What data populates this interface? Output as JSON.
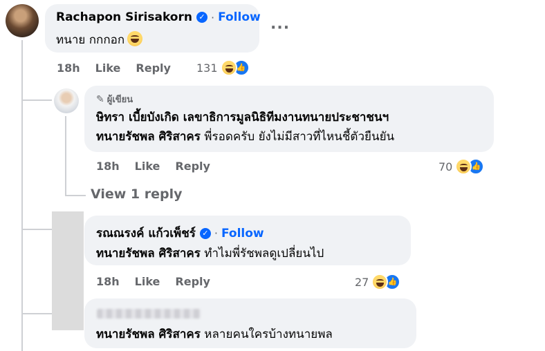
{
  "comments": [
    {
      "author": "Rachapon Sirisakorn",
      "follow": "Follow",
      "text": "ทนาย กกกอก",
      "time": "18h",
      "like": "Like",
      "reply": "Reply",
      "reactions": "131"
    },
    {
      "badge": "ผู้เขียน",
      "author": "ษิทรา เบี้ยบังเกิด เลขาธิการมูลนิธิทีมงานทนายประชาชนฯ",
      "mention": "ทนายรัชพล ศิริสาคร",
      "text": " พี่รอดครับ ยังไม่มีสาวที่ไหนชี้ตัวยืนยัน",
      "time": "18h",
      "like": "Like",
      "reply": "Reply",
      "reactions": "70"
    },
    {
      "author": "รณณรงค์ แก้วเพ็ชร์",
      "follow": "Follow",
      "mention": "ทนายรัชพล ศิริสาคร",
      "text": " ทำไมพี่รัชพลดูเปลี่ยนไป",
      "time": "18h",
      "like": "Like",
      "reply": "Reply",
      "reactions": "27"
    },
    {
      "mention": "ทนายรัชพล ศิริสาคร",
      "text": " หลายคนใครบ้างทนายพล"
    }
  ],
  "view_replies": "View 1 reply",
  "more_options": "···",
  "icons": {
    "verified": "verified-badge-icon",
    "haha": "haha-reaction-icon",
    "like": "like-reaction-icon",
    "pen": "pen-icon",
    "emoji": "grinning-sweat-emoji-icon"
  },
  "colors": {
    "accent": "#0866ff",
    "bubble": "#f0f2f5",
    "meta": "#65676b"
  }
}
